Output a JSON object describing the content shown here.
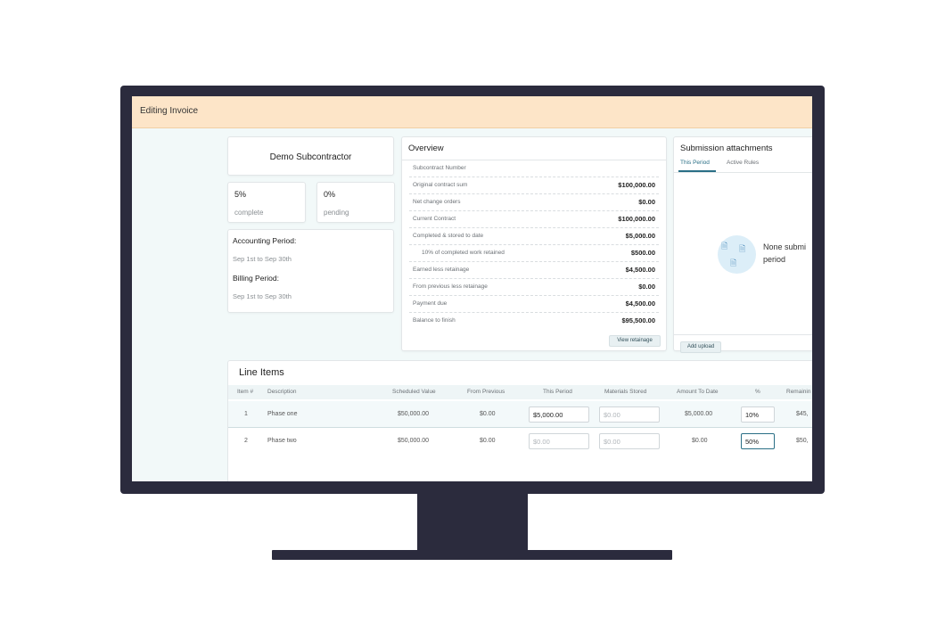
{
  "header": {
    "title": "Editing Invoice"
  },
  "subcontractor": {
    "name": "Demo Subcontractor"
  },
  "stats": [
    {
      "value": "5%",
      "label": "complete"
    },
    {
      "value": "0%",
      "label": "pending"
    }
  ],
  "periods": {
    "accounting_label": "Accounting Period:",
    "accounting_value": "Sep 1st to Sep 30th",
    "billing_label": "Billing Period:",
    "billing_value": "Sep 1st to Sep 30th"
  },
  "overview": {
    "title": "Overview",
    "rows": [
      {
        "label": "Subcontract Number",
        "value": ""
      },
      {
        "label": "Original contract sum",
        "value": "$100,000.00"
      },
      {
        "label": "Net change orders",
        "value": "$0.00"
      },
      {
        "label": "Current Contract",
        "value": "$100,000.00"
      },
      {
        "label": "Completed & stored to date",
        "value": "$5,000.00"
      },
      {
        "label": "10% of completed work retained",
        "value": "$500.00"
      },
      {
        "label": "Earned less retainage",
        "value": "$4,500.00"
      },
      {
        "label": "From previous less retainage",
        "value": "$0.00"
      },
      {
        "label": "Payment due",
        "value": "$4,500.00"
      },
      {
        "label": "Balance to finish",
        "value": "$95,500.00"
      }
    ],
    "view_retainage": "View retainage"
  },
  "attachments": {
    "title": "Submission attachments",
    "tabs": [
      "This Period",
      "Active Rules"
    ],
    "empty_message": "None submi\nperiod",
    "add_upload": "Add upload",
    "icon": "document-icon"
  },
  "line_items": {
    "title": "Line Items",
    "columns": [
      "Item #",
      "Description",
      "Scheduled Value",
      "From Previous",
      "This Period",
      "Materials Stored",
      "Amount To Date",
      "%",
      "Remainin"
    ],
    "rows": [
      {
        "item": "1",
        "description": "Phase one",
        "scheduled": "$50,000.00",
        "previous": "$0.00",
        "this_period": "$5,000.00",
        "materials": "$0.00",
        "amount": "$5,000.00",
        "pct": "10%",
        "remaining": "$45,"
      },
      {
        "item": "2",
        "description": "Phase two",
        "scheduled": "$50,000.00",
        "previous": "$0.00",
        "this_period": "$0.00",
        "materials": "$0.00",
        "amount": "$0.00",
        "pct": "50%",
        "remaining": "$50,"
      }
    ]
  },
  "colors": {
    "header_bg": "#fde5c8",
    "accent": "#2a6f86",
    "frame": "#2b2b3d"
  }
}
